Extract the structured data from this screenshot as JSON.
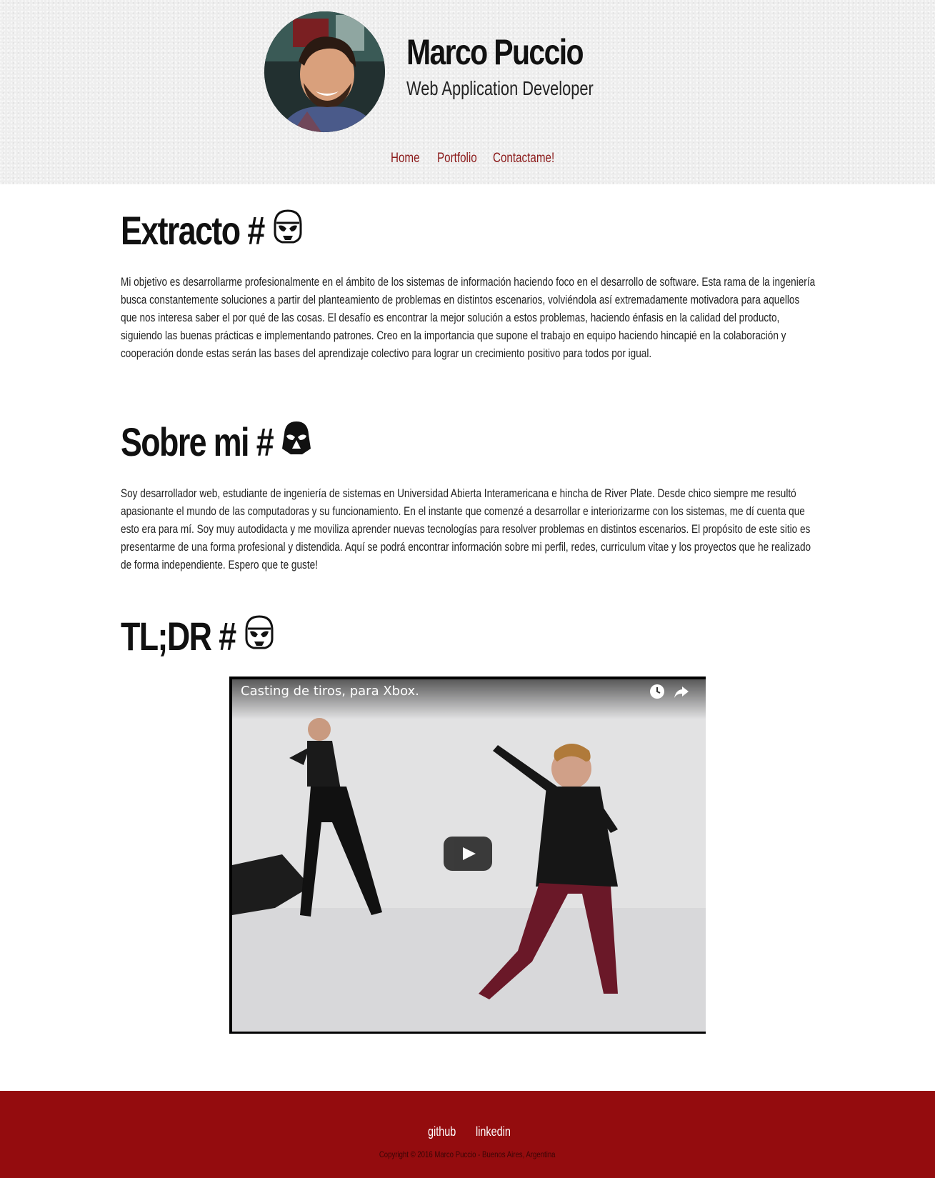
{
  "header": {
    "name": "Marco Puccio",
    "role": "Web Application Developer",
    "nav": [
      "Home",
      "Portfolio",
      "Contactame!"
    ]
  },
  "sections": [
    {
      "title": "Extracto #",
      "icon": "stormtrooper-icon",
      "text": "Mi objetivo es desarrollarme profesionalmente en el ámbito de los sistemas de información haciendo foco en el desarrollo de software. Esta rama de la ingeniería busca constantemente soluciones a partir del planteamiento de problemas en distintos escenarios, volviéndola así extremadamente motivadora para aquellos que nos interesa saber el por qué de las cosas. El desafío es encontrar la mejor solución a estos problemas, haciendo énfasis en la calidad del producto, siguiendo las buenas prácticas e implementando patrones. Creo en la importancia que supone el trabajo en equipo haciendo hincapié en la colaboración y cooperación donde estas serán las bases del aprendizaje colectivo para lograr un crecimiento positivo para todos por igual."
    },
    {
      "title": "Sobre mi #",
      "icon": "darth-vader-icon",
      "text": "Soy desarrollador web, estudiante de ingeniería de sistemas en Universidad Abierta Interamericana e hincha de River Plate. Desde chico siempre me resultó apasionante el mundo de las computadoras y su funcionamiento. En el instante que comenzé a desarrollar e interiorizarme con los sistemas, me dí cuenta que esto era para mí. Soy muy autodidacta y me moviliza aprender nuevas tecnologías para resolver problemas en distintos escenarios. El propósito de este sitio es presentarme de una forma profesional y distendida. Aquí se podrá encontrar información sobre mi perfil, redes, curriculum vitae y los proyectos que he realizado de forma independiente. Espero que te guste!"
    },
    {
      "title": "TL;DR #",
      "icon": "stormtrooper-icon"
    }
  ],
  "video": {
    "title": "Casting de tiros, para Xbox."
  },
  "footer": {
    "links": [
      "github",
      "linkedin"
    ],
    "copyright": "Copyright © 2016 Marco Puccio - Buenos Aires, Argentina"
  },
  "colors": {
    "accent": "#940c0e",
    "nav_link": "#8b1a1a"
  }
}
